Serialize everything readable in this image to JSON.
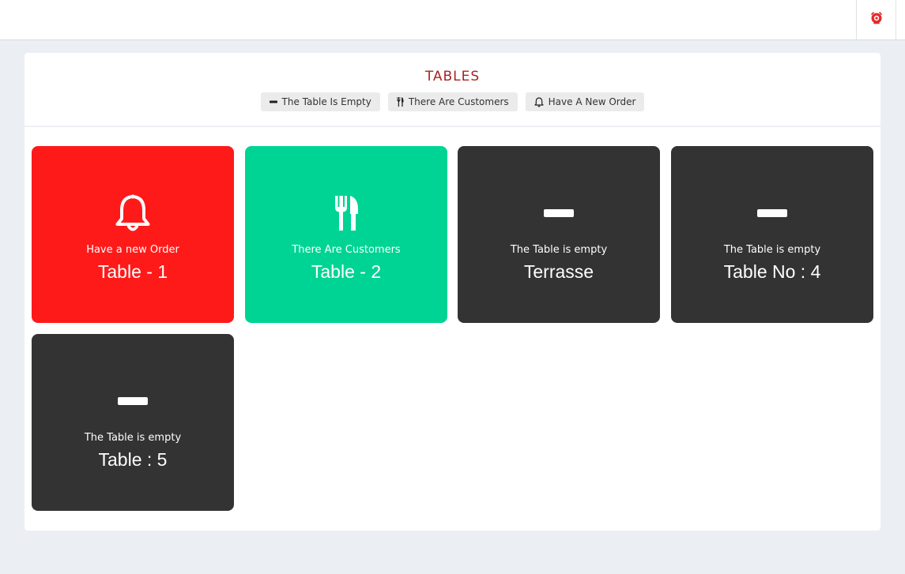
{
  "page": {
    "title": "TABLES"
  },
  "colors": {
    "new_order": "#ff1a1a",
    "customers": "#00d494",
    "empty": "#333333",
    "title": "#a82323"
  },
  "legend": [
    {
      "icon": "minus-icon",
      "label": "The Table Is Empty"
    },
    {
      "icon": "utensils-icon",
      "label": "There Are Customers"
    },
    {
      "icon": "bell-icon",
      "label": "Have A New Order"
    }
  ],
  "tables": [
    {
      "status": "Have a new Order",
      "name": "Table - 1",
      "state": "new_order",
      "icon": "bell-icon"
    },
    {
      "status": "There Are Customers",
      "name": "Table - 2",
      "state": "customers",
      "icon": "utensils-icon"
    },
    {
      "status": "The Table is empty",
      "name": "Terrasse",
      "state": "empty",
      "icon": "minus-icon"
    },
    {
      "status": "The Table is empty",
      "name": "Table No : 4",
      "state": "empty",
      "icon": "minus-icon"
    },
    {
      "status": "The Table is empty",
      "name": "Table : 5",
      "state": "empty",
      "icon": "minus-icon"
    }
  ]
}
